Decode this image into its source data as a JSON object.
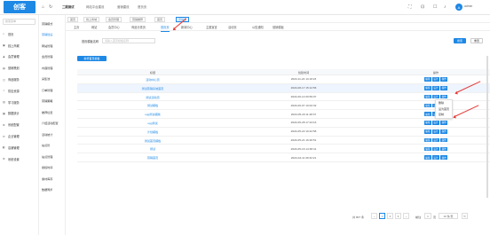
{
  "app": {
    "logo": "创客"
  },
  "topbar": {
    "nav": [
      "二期测试",
      "网站平台建设",
      "营销建设",
      "首页页"
    ],
    "user_initial": "A",
    "user_name": "admin"
  },
  "sidebar": {
    "search_placeholder": "搜索菜单",
    "items": [
      {
        "icon": "home-icon",
        "glyph": "⌂",
        "label": "首页"
      },
      {
        "icon": "store-icon",
        "glyph": "▣",
        "label": "线上商城"
      },
      {
        "icon": "user-icon",
        "glyph": "♟",
        "label": "会员管理"
      },
      {
        "icon": "chart-icon",
        "glyph": "▤",
        "label": "营销策划"
      },
      {
        "icon": "cart-icon",
        "glyph": "◫",
        "label": "商品服务"
      },
      {
        "icon": "star-icon",
        "glyph": "☆",
        "label": "供应资源"
      },
      {
        "icon": "book-icon",
        "glyph": "▥",
        "label": "学习服务"
      },
      {
        "icon": "data-icon",
        "glyph": "▦",
        "label": "数据统计"
      },
      {
        "icon": "gear-icon",
        "glyph": "⚙",
        "label": "系统配置"
      },
      {
        "icon": "msg-icon",
        "glyph": "✉",
        "label": "企业管理"
      },
      {
        "icon": "site-icon",
        "glyph": "◧",
        "label": "店铺管理"
      },
      {
        "icon": "setting-icon",
        "glyph": "⚙",
        "label": "系统设置"
      }
    ]
  },
  "subsidebar": {
    "items": [
      "营销模式",
      "营销建设",
      "网站管理",
      "会员管理",
      "内容管理",
      "采集池",
      "订单管理",
      "营销策略",
      "推荐位置",
      "介绍活动配置",
      "活动统计",
      "站点管",
      "站点管理",
      "授权时间",
      "素材库存",
      "数据同步"
    ],
    "active_index": 1
  },
  "tabs": [
    "首页",
    "线上商城",
    "会员管理",
    "营销推荐",
    "首页",
    "营销页"
  ],
  "active_tab_index": 5,
  "subtabs": [
    "主页",
    "网站",
    "会员中心",
    "商品分类页",
    "首页页",
    "新闻中心",
    "主题宣言",
    "活动页",
    "公告通知",
    "营销模板"
  ],
  "active_subtab_index": 4,
  "filter": {
    "label": "首页模板名称",
    "placeholder": "请输入首页模板名称",
    "search_label": "搜索",
    "reset_label": "重置"
  },
  "add_button": "新增首页模板",
  "table": {
    "columns": [
      "标题",
      "创建时间",
      "操作"
    ],
    "rows": [
      {
        "name": "活动中心页",
        "date": "2024-11-24 14:18:23"
      },
      {
        "name": "测试营销系统首页",
        "date": "2024-08-17 15:12:56"
      },
      {
        "name": "测试活动页",
        "date": "2024-06-14 09:59:07"
      },
      {
        "name": "测试模板",
        "date": "2024-06-07 10:02:32"
      },
      {
        "name": "egg测试模版",
        "date": "2024-05-29 11:48:37"
      },
      {
        "name": "egg测试",
        "date": "2024-05-28 17:24:16"
      },
      {
        "name": "计划模板",
        "date": "2024-05-22 19:42:58"
      },
      {
        "name": "测试首页模板",
        "date": "2024-05-21 16:20:51"
      },
      {
        "name": "测试",
        "date": "2024-05-16 14:38:41"
      },
      {
        "name": "营销首页",
        "date": "2024-04-11 09:32:21"
      }
    ],
    "op_labels": [
      "编辑",
      "设计",
      "操作"
    ],
    "highlight_index": 1
  },
  "dropdown": [
    "删除",
    "设为首页",
    "复制"
  ],
  "pagination": {
    "total": "共 807 条",
    "pages": [
      "1",
      "2",
      "3"
    ],
    "active_page": "1",
    "per_page": "10 条/页",
    "goto_label": "前往",
    "goto_value": "1",
    "page_suffix": "页"
  },
  "colors": {
    "accent": "#1e88e5",
    "annotation": "#e53935"
  }
}
